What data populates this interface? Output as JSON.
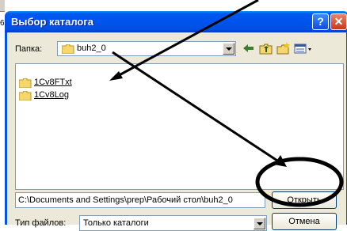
{
  "background": {
    "side_number": "6"
  },
  "window": {
    "title": "Выбор каталога",
    "help_label": "?",
    "close_label": "✕"
  },
  "look_in": {
    "label": "Папка:",
    "value": "buh2_0"
  },
  "toolbar": {
    "icons": [
      "back-arrow-icon",
      "up-folder-icon",
      "new-folder-icon",
      "view-menu-icon"
    ]
  },
  "folder_list": {
    "items": [
      {
        "name": "1Cv8FTxt"
      },
      {
        "name": "1Cv8Log"
      }
    ]
  },
  "path_field": {
    "value": "C:\\Documents and Settings\\prep\\Рабочий стол\\buh2_0"
  },
  "buttons": {
    "open_label": "Открыть",
    "cancel_label": "Отмена"
  },
  "file_type": {
    "label": "Тип файлов:",
    "value": "Только каталоги"
  },
  "colors": {
    "titlebar": "#0054e3",
    "dialog_bg": "#ece9d8",
    "annotation": "#000000"
  }
}
